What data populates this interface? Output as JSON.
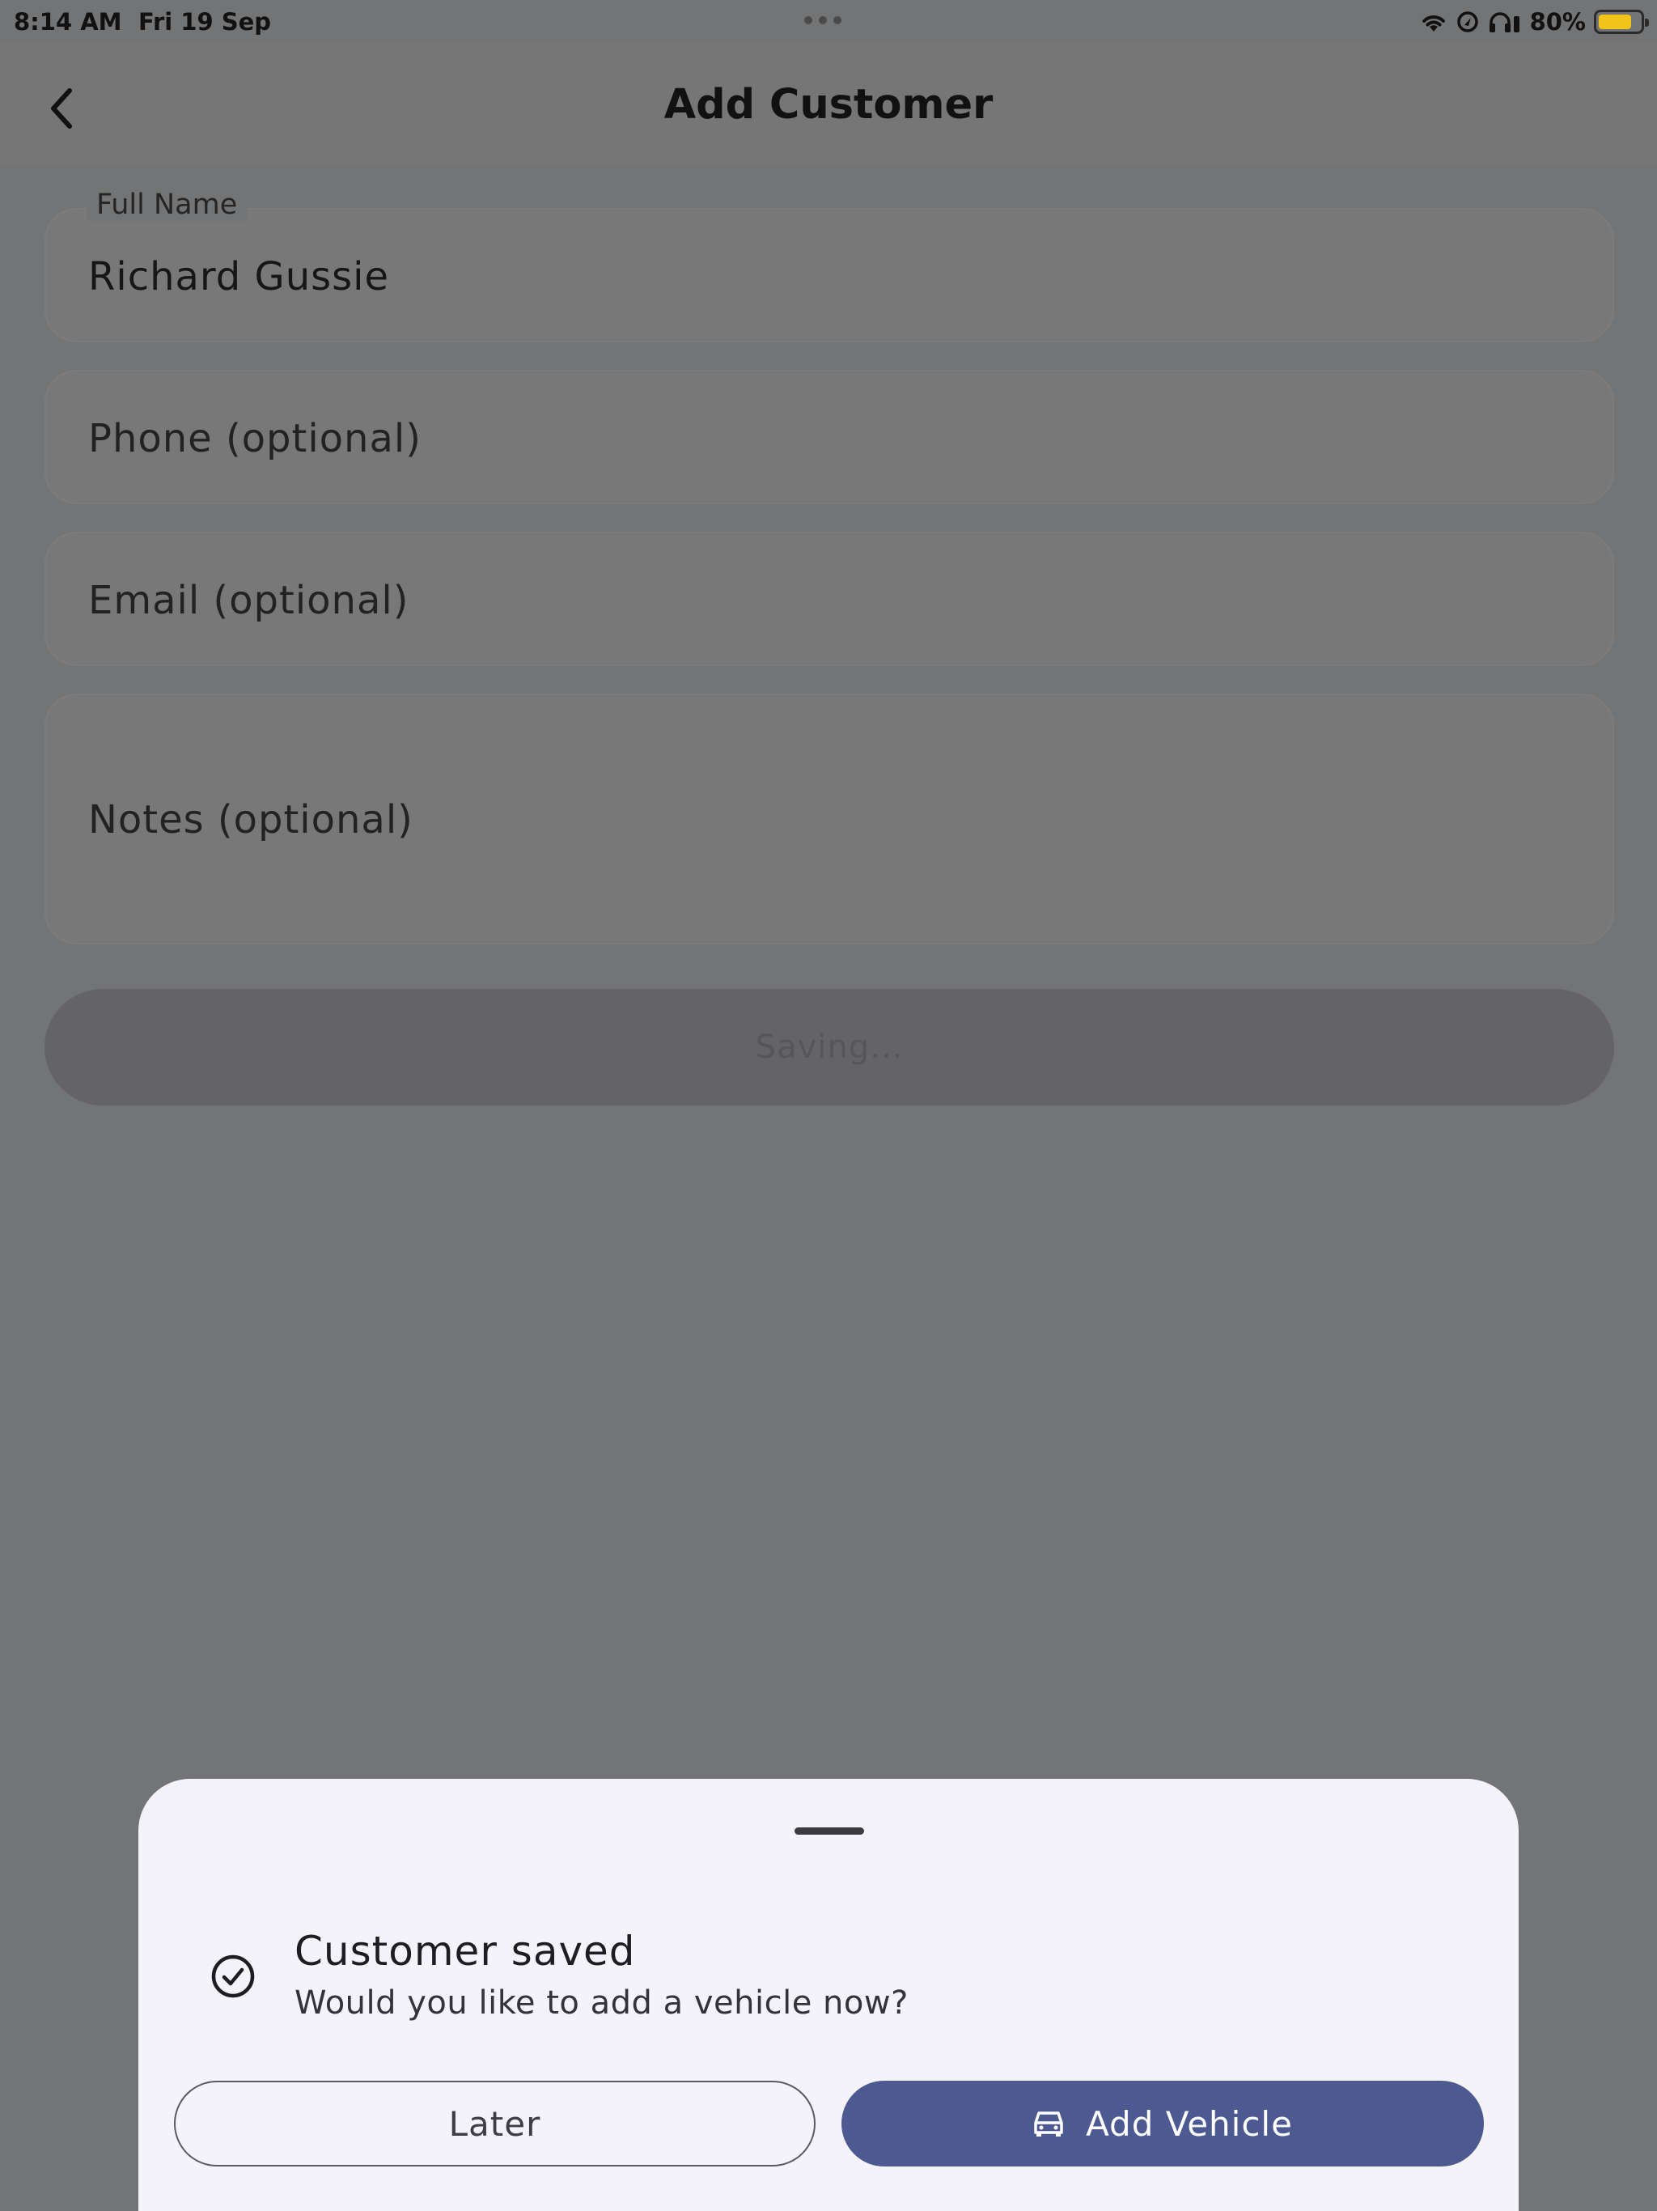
{
  "status_bar": {
    "time": "8:14 AM",
    "date": "Fri 19 Sep",
    "battery_percent_label": "80%",
    "battery_level": 0.8,
    "icons": [
      "wifi-icon",
      "location-lock-icon",
      "headphones-icon",
      "battery-icon"
    ]
  },
  "nav": {
    "title": "Add Customer",
    "back_icon": "chevron-left-icon"
  },
  "form": {
    "full_name_label": "Full Name",
    "full_name_value": "Richard Gussie",
    "phone_placeholder": "Phone (optional)",
    "email_placeholder": "Email (optional)",
    "notes_placeholder": "Notes (optional)",
    "save_label": "Saving..."
  },
  "sheet": {
    "title": "Customer saved",
    "subtitle": "Would you like to add a vehicle now?",
    "later_label": "Later",
    "add_vehicle_label": "Add Vehicle",
    "check_icon": "check-circle-icon",
    "car_icon": "car-icon"
  },
  "colors": {
    "overlay_background": "#737475",
    "sheet_background": "#f3f3f9",
    "primary_button": "#4c5a91",
    "battery_fill": "#f2c318"
  }
}
